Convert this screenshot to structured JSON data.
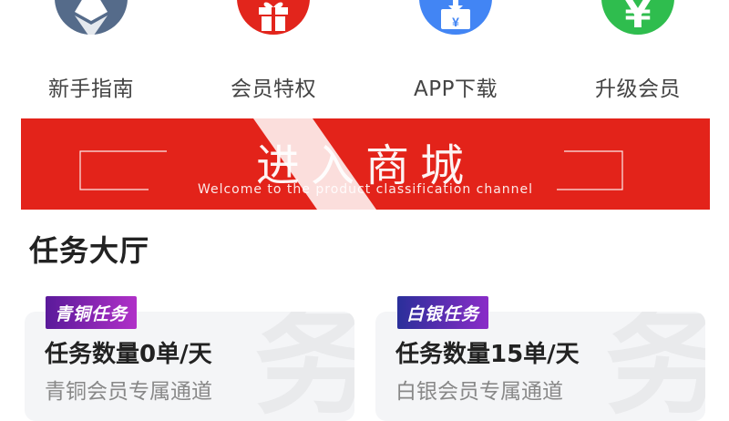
{
  "quick_nav": [
    {
      "label": "新手指南",
      "icon": "ethereum-icon",
      "color": "#556b8a"
    },
    {
      "label": "会员特权",
      "icon": "gift-icon",
      "color": "#e2251c"
    },
    {
      "label": "APP下载",
      "icon": "download-icon",
      "color": "#4285f4"
    },
    {
      "label": "升级会员",
      "icon": "yen-icon",
      "color": "#2fbd4e"
    }
  ],
  "banner": {
    "title": "进入商城",
    "subtitle": "Welcome to the product classification channel",
    "color": "#e3231a"
  },
  "section": {
    "title": "任务大厅"
  },
  "tasks": [
    {
      "badge": "青铜任务",
      "count": "任务数量0单/天",
      "desc": "青铜会员专属通道"
    },
    {
      "badge": "白银任务",
      "count": "任务数量15单/天",
      "desc": "白银会员专属通道"
    }
  ]
}
